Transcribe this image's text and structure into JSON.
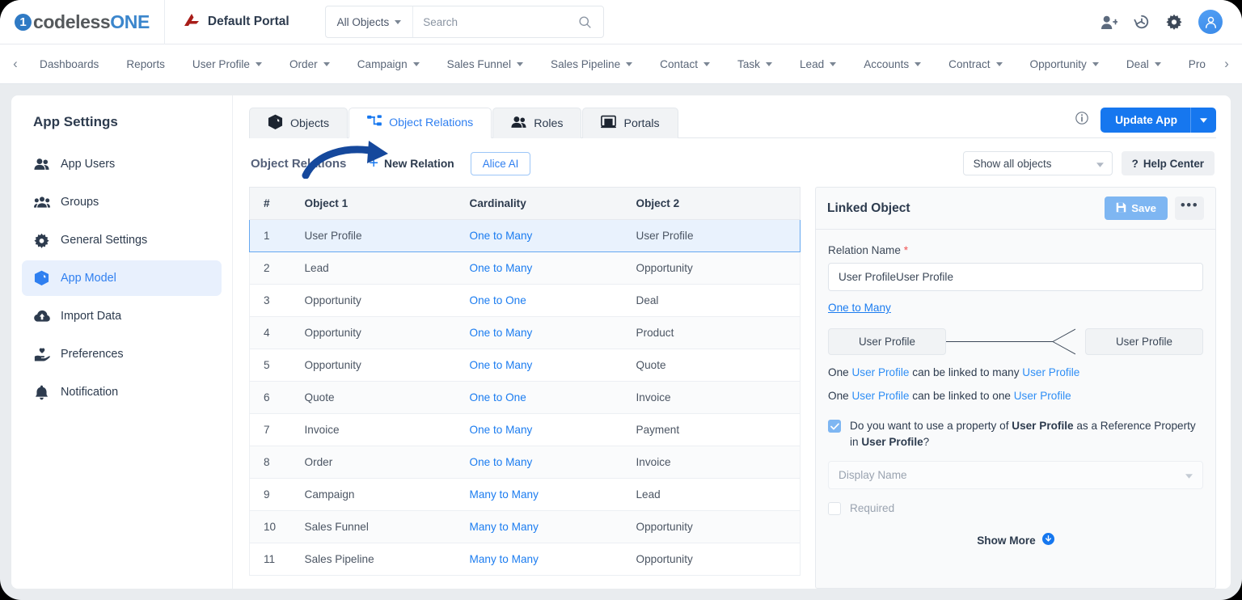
{
  "header": {
    "logo": {
      "digit": "1",
      "part1": "codeless",
      "part2": "ONE"
    },
    "portal_label": "Default Portal",
    "portal_icon": "portal-mark-icon",
    "search": {
      "scope_label": "All Objects",
      "placeholder": "Search",
      "value": ""
    },
    "icons": [
      "add-user-icon",
      "history-icon",
      "gear-icon",
      "avatar-icon"
    ]
  },
  "nav": {
    "prev_icon": "chevron-left-icon",
    "next_icon": "chevron-right-icon",
    "items": [
      {
        "label": "Dashboards",
        "caret": false
      },
      {
        "label": "Reports",
        "caret": false
      },
      {
        "label": "User Profile",
        "caret": true
      },
      {
        "label": "Order",
        "caret": true
      },
      {
        "label": "Campaign",
        "caret": true
      },
      {
        "label": "Sales Funnel",
        "caret": true
      },
      {
        "label": "Sales Pipeline",
        "caret": true
      },
      {
        "label": "Contact",
        "caret": true
      },
      {
        "label": "Task",
        "caret": true
      },
      {
        "label": "Lead",
        "caret": true
      },
      {
        "label": "Accounts",
        "caret": true
      },
      {
        "label": "Contract",
        "caret": true
      },
      {
        "label": "Opportunity",
        "caret": true
      },
      {
        "label": "Deal",
        "caret": true
      },
      {
        "label": "Pro",
        "caret": false
      }
    ]
  },
  "sidebar": {
    "title": "App Settings",
    "items": [
      {
        "label": "App Users",
        "icon": "users-icon",
        "active": false
      },
      {
        "label": "Groups",
        "icon": "group-icon",
        "active": false
      },
      {
        "label": "General Settings",
        "icon": "gear-icon",
        "active": false
      },
      {
        "label": "App Model",
        "icon": "cube-icon",
        "active": true
      },
      {
        "label": "Import Data",
        "icon": "cloud-upload-icon",
        "active": false
      },
      {
        "label": "Preferences",
        "icon": "hand-heart-icon",
        "active": false
      },
      {
        "label": "Notification",
        "icon": "bell-icon",
        "active": false
      }
    ]
  },
  "tabs": [
    {
      "label": "Objects",
      "icon": "cube-icon",
      "active": false
    },
    {
      "label": "Object Relations",
      "icon": "sitemap-icon",
      "active": true
    },
    {
      "label": "Roles",
      "icon": "users-icon",
      "active": false
    },
    {
      "label": "Portals",
      "icon": "monitor-icon",
      "active": false
    }
  ],
  "tabs_right": {
    "info_icon": "info-icon",
    "update_label": "Update App",
    "update_caret_icon": "chevron-down-icon"
  },
  "toolbar": {
    "title": "Object Relations",
    "new_relation_label": "New Relation",
    "plus_icon": "plus-icon",
    "alice_label": "Alice AI",
    "filter_value": "Show all objects",
    "filter_caret_icon": "chevron-down-icon",
    "help_center_label": "Help Center",
    "help_icon": "question-mark-icon",
    "annotation_arrow_icon": "curved-arrow-icon",
    "annotation_color": "#15489c"
  },
  "table": {
    "columns": [
      "#",
      "Object 1",
      "Cardinality",
      "Object 2"
    ],
    "rows": [
      {
        "n": "1",
        "o1": "User Profile",
        "card": "One to Many",
        "o2": "User Profile",
        "selected": true
      },
      {
        "n": "2",
        "o1": "Lead",
        "card": "One to Many",
        "o2": "Opportunity",
        "selected": false
      },
      {
        "n": "3",
        "o1": "Opportunity",
        "card": "One to One",
        "o2": "Deal",
        "selected": false
      },
      {
        "n": "4",
        "o1": "Opportunity",
        "card": "One to Many",
        "o2": "Product",
        "selected": false
      },
      {
        "n": "5",
        "o1": "Opportunity",
        "card": "One to Many",
        "o2": "Quote",
        "selected": false
      },
      {
        "n": "6",
        "o1": "Quote",
        "card": "One to One",
        "o2": "Invoice",
        "selected": false
      },
      {
        "n": "7",
        "o1": "Invoice",
        "card": "One to Many",
        "o2": "Payment",
        "selected": false
      },
      {
        "n": "8",
        "o1": "Order",
        "card": "One to Many",
        "o2": "Invoice",
        "selected": false
      },
      {
        "n": "9",
        "o1": "Campaign",
        "card": "Many to Many",
        "o2": "Lead",
        "selected": false
      },
      {
        "n": "10",
        "o1": "Sales Funnel",
        "card": "Many to Many",
        "o2": "Opportunity",
        "selected": false
      },
      {
        "n": "11",
        "o1": "Sales Pipeline",
        "card": "Many to Many",
        "o2": "Opportunity",
        "selected": false
      }
    ]
  },
  "linked_object": {
    "title": "Linked Object",
    "save_label": "Save",
    "save_icon": "floppy-disk-icon",
    "more_label": "•••",
    "relation_name_label": "Relation Name",
    "required_marker": "*",
    "relation_name_value": "User ProfileUser Profile",
    "cardinality_link": "One to Many",
    "er": {
      "left": "User Profile",
      "right": "User Profile",
      "notation": "crow-foot-icon"
    },
    "statements": [
      {
        "p1": "One ",
        "o1": "User Profile",
        "p2": " can be linked to many ",
        "o2": "User Profile"
      },
      {
        "p1": "One ",
        "o1": "User Profile",
        "p2": " can be linked to one ",
        "o2": "User Profile"
      }
    ],
    "reference_checkbox": {
      "checked": true,
      "t1": "Do you want to use a property of ",
      "b1": "User Profile",
      "t2": " as a Reference Property in ",
      "b2": "User Profile",
      "t3": "?"
    },
    "display_name_placeholder": "Display Name",
    "display_name_caret_icon": "chevron-down-icon",
    "required_checkbox": {
      "checked": false,
      "label": "Required"
    },
    "show_more_label": "Show More",
    "show_more_icon": "circle-arrow-down-icon"
  },
  "colors": {
    "accent": "#1677ef",
    "link": "#1b7cf0",
    "selected_row": "#e9f2fd",
    "sidebar_active": "#e8f0fd",
    "save_button": "#7eb6f2",
    "brand_red": "#a81d19",
    "required": "#f05252"
  }
}
